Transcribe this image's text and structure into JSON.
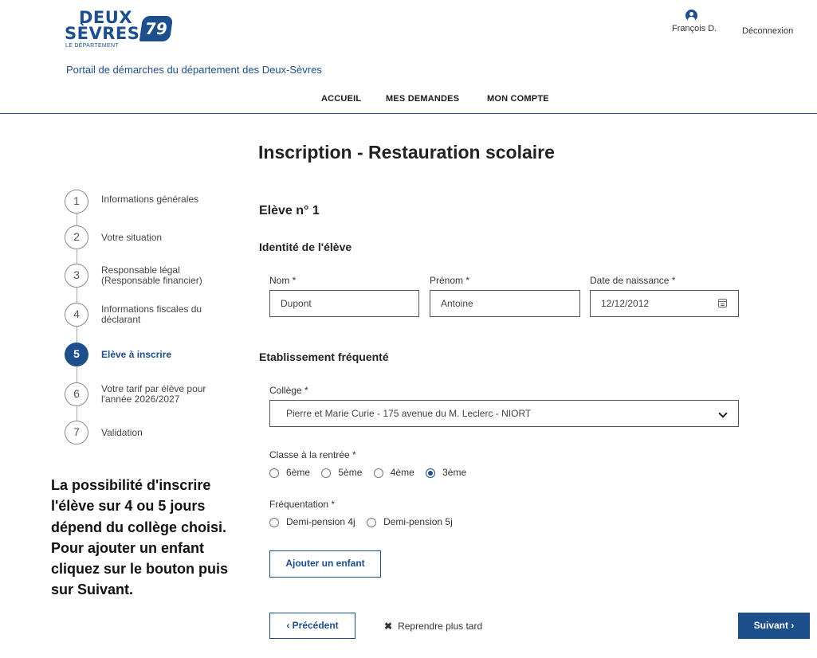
{
  "header": {
    "logo_line1": "DEUX",
    "logo_line2": "SÈVRES",
    "logo_sub": "LE DÉPARTEMENT",
    "logo_badge": "79",
    "tagline": "Portail de démarches du département des Deux-Sèvres",
    "user_name": "François D.",
    "logout": "Déconnexion"
  },
  "nav": [
    "ACCUEIL",
    "MES DEMANDES",
    "MON COMPTE"
  ],
  "page_title": "Inscription - Restauration scolaire",
  "steps": [
    {
      "num": "1",
      "label": "Informations générales"
    },
    {
      "num": "2",
      "label": "Votre situation"
    },
    {
      "num": "3",
      "label": "Responsable légal (Responsable financier)"
    },
    {
      "num": "4",
      "label": "Informations fiscales du déclarant"
    },
    {
      "num": "5",
      "label": "Elève à inscrire"
    },
    {
      "num": "6",
      "label": "Votre tarif par élève pour l'année 2026/2027"
    },
    {
      "num": "7",
      "label": "Validation"
    }
  ],
  "form": {
    "student_heading": "Elève n° 1",
    "identity_heading": "Identité de l'élève",
    "nom_label": "Nom *",
    "nom_value": "Dupont",
    "prenom_label": "Prénom *",
    "prenom_value": "Antoine",
    "dob_label": "Date de naissance *",
    "dob_value": "12/12/2012",
    "school_heading": "Etablissement fréquenté",
    "college_label": "Collège *",
    "college_value": "Pierre et Marie Curie - 175 avenue du M. Leclerc - NIORT",
    "classe_label": "Classe à la rentrée *",
    "classe_options": [
      "6ème",
      "5ème",
      "4ème",
      "3ème"
    ],
    "classe_selected": "3ème",
    "freq_label": "Fréquentation *",
    "freq_options": [
      "Demi-pension 4j",
      "Demi-pension 5j"
    ],
    "add_child": "Ajouter un enfant"
  },
  "footer": {
    "prev": "‹ Précédent",
    "later": "Reprendre plus tard",
    "next": "Suivant ›"
  },
  "callout": "La possibilité d'inscrire l'élève sur 4 ou 5 jours dépend du collège choisi. Pour ajouter un enfant cliquez sur le bouton puis sur Suivant.",
  "colors": {
    "brand": "#1c4f8c"
  }
}
